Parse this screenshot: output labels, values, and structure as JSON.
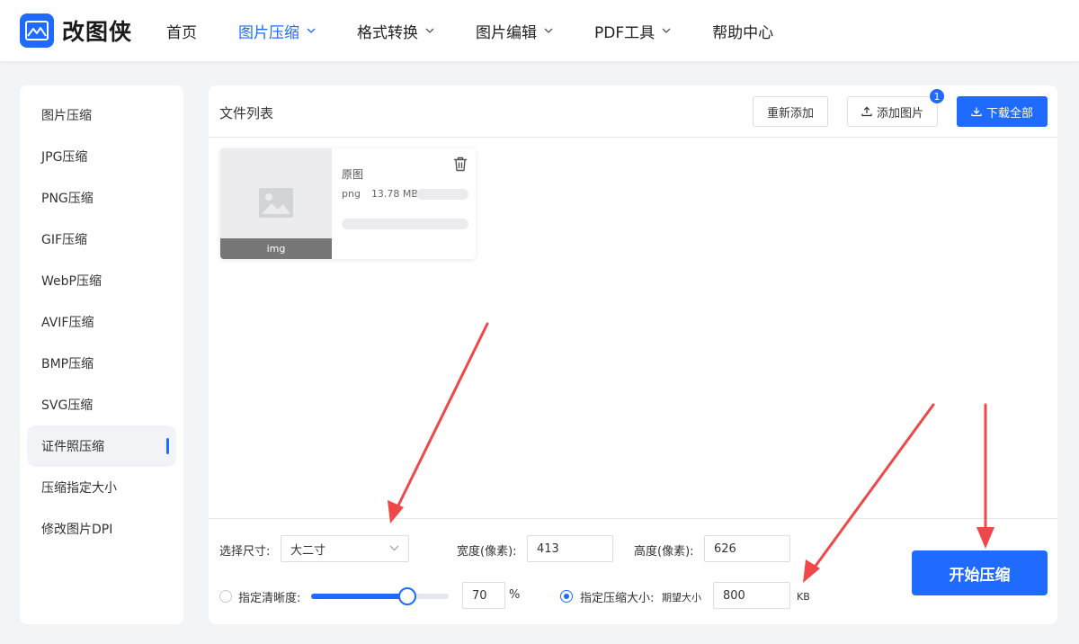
{
  "brand": {
    "name": "改图侠",
    "accent": "#1f6bff"
  },
  "nav": [
    {
      "label": "首页",
      "dropdown": false,
      "active": false
    },
    {
      "label": "图片压缩",
      "dropdown": true,
      "active": true
    },
    {
      "label": "格式转换",
      "dropdown": true,
      "active": false
    },
    {
      "label": "图片编辑",
      "dropdown": true,
      "active": false
    },
    {
      "label": "PDF工具",
      "dropdown": true,
      "active": false
    },
    {
      "label": "帮助中心",
      "dropdown": false,
      "active": false
    }
  ],
  "sidebar": {
    "items": [
      {
        "label": "图片压缩"
      },
      {
        "label": "JPG压缩"
      },
      {
        "label": "PNG压缩"
      },
      {
        "label": "GIF压缩"
      },
      {
        "label": "WebP压缩"
      },
      {
        "label": "AVIF压缩"
      },
      {
        "label": "BMP压缩"
      },
      {
        "label": "SVG压缩"
      },
      {
        "label": "证件照压缩",
        "active": true
      },
      {
        "label": "压缩指定大小"
      },
      {
        "label": "修改图片DPI"
      }
    ]
  },
  "file_list": {
    "title": "文件列表",
    "readd_label": "重新添加",
    "add_label": "添加图片",
    "add_count": "1",
    "download_label": "下载全部"
  },
  "file_card": {
    "thumb_label": "img",
    "name": "原图",
    "format": "png",
    "size": "13.78 MB"
  },
  "options": {
    "size_label": "选择尺寸:",
    "size_value": "大二寸",
    "width_label": "宽度(像素):",
    "width_value": "413",
    "height_label": "高度(像素):",
    "height_value": "626",
    "clarity_label": "指定清晰度:",
    "clarity_selected": false,
    "clarity_slider_fraction": 0.7,
    "clarity_value": "70",
    "clarity_unit": "%",
    "target_label": "指定压缩大小:",
    "target_selected": true,
    "target_hint": "期望大小",
    "target_value": "800",
    "target_unit": "KB",
    "start_label": "开始压缩"
  },
  "annotation_color": "#f04848"
}
